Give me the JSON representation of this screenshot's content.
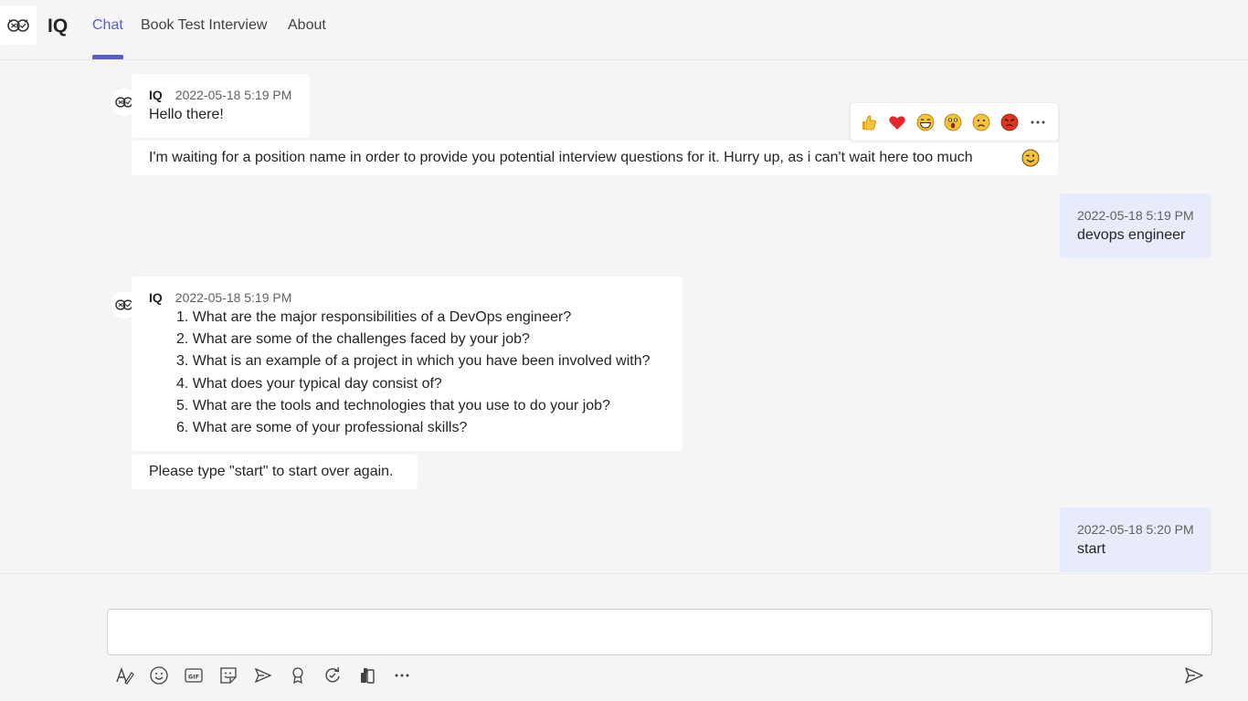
{
  "app": {
    "name": "IQ"
  },
  "tabs": [
    {
      "label": "Chat",
      "active": true
    },
    {
      "label": "Book Test Interview",
      "active": false
    },
    {
      "label": "About",
      "active": false
    }
  ],
  "colors": {
    "accent": "#5b5fc7",
    "presence": "#6bb700",
    "self_bubble": "#e8ebfa"
  },
  "messages": {
    "bot1": {
      "sender": "IQ",
      "timestamp": "2022-05-18 5:19 PM",
      "text": "Hello there!",
      "followup": "I'm waiting for a position name in order to provide you potential interview questions for it. Hurry up, as i can't wait here too much"
    },
    "user1": {
      "timestamp": "2022-05-18 5:19 PM",
      "text": "devops engineer"
    },
    "bot2": {
      "sender": "IQ",
      "timestamp": "2022-05-18 5:19 PM",
      "questions": [
        "1. What are the major responsibilities of a DevOps engineer?",
        "2. What are some of the challenges faced by your job?",
        "3. What is an example of a project in which you have been involved with?",
        "4. What does your typical day consist of?",
        "5. What are the tools and technologies that you use to do your job?",
        "6. What are some of your professional skills?"
      ],
      "followup": "Please type \"start\" to start over again."
    },
    "user2": {
      "timestamp": "2022-05-18 5:20 PM",
      "text": "start"
    }
  },
  "reactions": [
    "like",
    "heart",
    "laugh",
    "surprised",
    "sad",
    "angry",
    "more"
  ],
  "compose": {
    "placeholder": "",
    "tools": [
      "format-icon",
      "emoji-icon",
      "gif-icon",
      "sticker-icon",
      "meet-now-icon",
      "praise-icon",
      "loop-icon",
      "apps-icon",
      "more-icon"
    ]
  }
}
